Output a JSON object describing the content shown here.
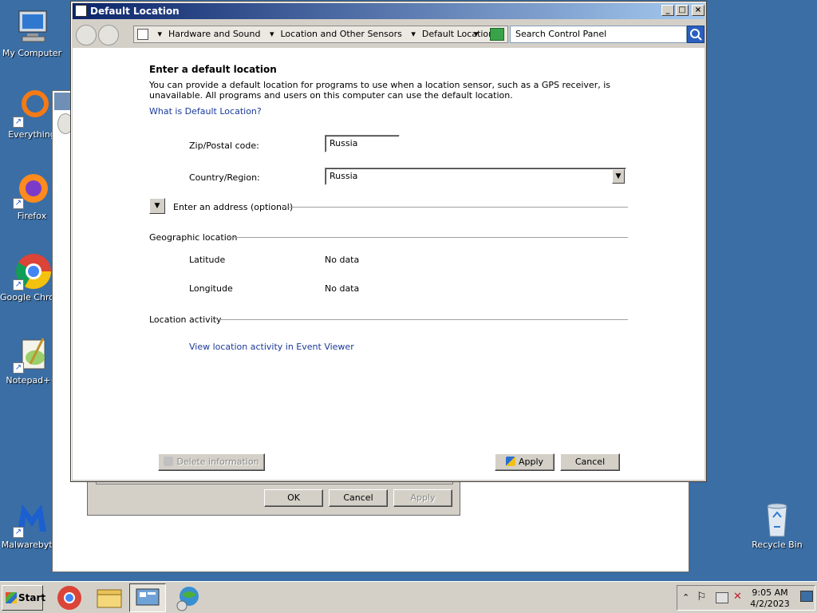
{
  "desktop": {
    "icons": [
      {
        "label": "My Computer"
      },
      {
        "label": "Everything"
      },
      {
        "label": "Firefox"
      },
      {
        "label": "Google Chrome"
      },
      {
        "label": "Notepad++"
      },
      {
        "label": "Malwarebytes"
      },
      {
        "label": "Recycle Bin"
      }
    ]
  },
  "bg_dialog": {
    "ok_label": "OK",
    "cancel_label": "Cancel",
    "apply_label": "Apply"
  },
  "window": {
    "title": "Default Location",
    "breadcrumb": [
      "Hardware and Sound",
      "Location and Other Sensors",
      "Default Location"
    ],
    "search_placeholder": "Search Control Panel"
  },
  "content": {
    "heading": "Enter a default location",
    "description": "You can provide a default location for programs to use when a location sensor, such as a GPS receiver, is unavailable. All programs and users on this computer can use the default location.",
    "help_link": "What is Default Location?",
    "zip_label": "Zip/Postal code:",
    "zip_value": "Russia",
    "country_label": "Country/Region:",
    "country_value": "Russia",
    "address_toggle": "Enter an address (optional)",
    "geo_section": "Geographic location",
    "latitude_label": "Latitude",
    "latitude_value": "No data",
    "longitude_label": "Longitude",
    "longitude_value": "No data",
    "activity_section": "Location activity",
    "activity_link": "View location activity in Event Viewer",
    "delete_label": "Delete information",
    "apply_label": "Apply",
    "cancel_label": "Cancel"
  },
  "taskbar": {
    "start_label": "Start",
    "time": "9:05 AM",
    "date": "4/2/2023"
  },
  "colors": {
    "desktop": "#3a6ea5",
    "title_gradient_start": "#0a246a",
    "title_gradient_end": "#a6caf0",
    "link": "#1a3a9a"
  }
}
